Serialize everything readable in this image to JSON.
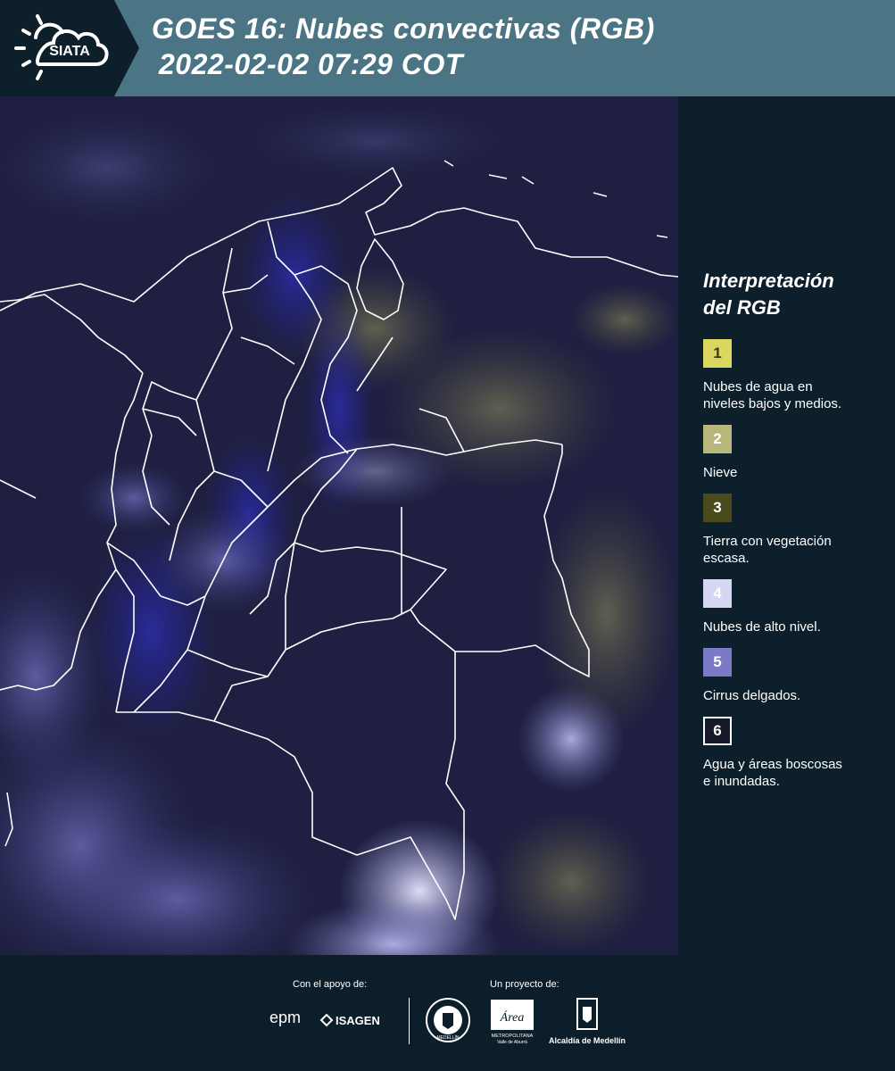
{
  "header": {
    "logo_text": "SIATA",
    "title_line1": "GOES 16: Nubes convectivas (RGB)",
    "title_line2": "2022-02-02 07:29 COT"
  },
  "map": {
    "background_color": "#1a1c3a",
    "border_color": "#ffffff"
  },
  "legend": {
    "title_line1": "Interpretación",
    "title_line2": "del RGB",
    "items": [
      {
        "number": "1",
        "color": "#d9d760",
        "text_color": "#3a3a1a",
        "label_line1": "Nubes de agua en",
        "label_line2": "niveles bajos y medios."
      },
      {
        "number": "2",
        "color": "#b7b77a",
        "text_color": "#ffffff",
        "label_line1": "Nieve",
        "label_line2": ""
      },
      {
        "number": "3",
        "color": "#4a4a1c",
        "text_color": "#ffffff",
        "label_line1": "Tierra con vegetación",
        "label_line2": "escasa."
      },
      {
        "number": "4",
        "color": "#d6d6f2",
        "text_color": "#ffffff",
        "label_line1": "Nubes de alto nivel.",
        "label_line2": ""
      },
      {
        "number": "5",
        "color": "#7a7ac8",
        "text_color": "#ffffff",
        "label_line1": "Cirrus delgados.",
        "label_line2": ""
      },
      {
        "number": "6",
        "color": "#141a2a",
        "text_color": "#ffffff",
        "label_line1": "Agua y áreas boscosas",
        "label_line2": "e inundadas."
      }
    ]
  },
  "footer": {
    "support_caption": "Con el apoyo de:",
    "project_caption": "Un proyecto de:",
    "logo_epm": "epm",
    "logo_isagen": "ISAGEN",
    "logo_area_word": "Área",
    "logo_area_sub": "METROPOLITANA",
    "logo_area_sub2": "Valle de Aburrá",
    "logo_alcaldia": "Alcaldía de Medellín",
    "logo_seal_text": "MEDELLÍN"
  }
}
